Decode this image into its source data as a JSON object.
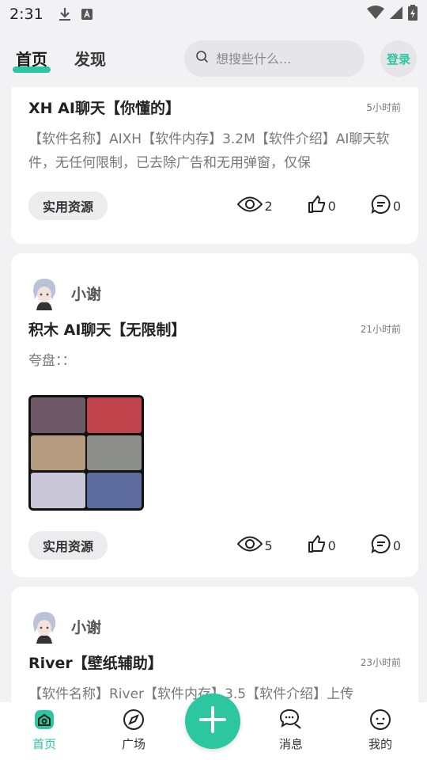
{
  "status_bar": {
    "time": "2:31"
  },
  "header": {
    "tabs": [
      {
        "label": "首页",
        "active": true
      },
      {
        "label": "发现",
        "active": false
      }
    ],
    "search": {
      "placeholder": "想搜些什么..."
    },
    "login_label": "登录"
  },
  "posts": [
    {
      "title": "XH AI聊天【你懂的】",
      "time": "5小时前",
      "excerpt": "【软件名称】AIXH【软件内存】3.2M【软件介绍】AI聊天软件，无任何限制，已去除广告和无用弹窗，仅保",
      "tag": "实用资源",
      "views": "2",
      "likes": "0",
      "comments": "0"
    },
    {
      "author": "小谢",
      "title": "积木 AI聊天【无限制】",
      "time": "21小时前",
      "excerpt": "夸盘：：",
      "tag": "实用资源",
      "views": "5",
      "likes": "0",
      "comments": "0"
    },
    {
      "author": "小谢",
      "title": "River【壁纸辅助】",
      "time": "23小时前",
      "excerpt": "【软件名称】River【软件内存】3.5【软件介绍】上传"
    }
  ],
  "bottom_nav": [
    {
      "label": "首页",
      "icon": "home-icon",
      "active": true
    },
    {
      "label": "广场",
      "icon": "compass-icon",
      "active": false
    },
    {
      "label": "消息",
      "icon": "chat-icon",
      "active": false
    },
    {
      "label": "我的",
      "icon": "profile-icon",
      "active": false
    }
  ],
  "colors": {
    "accent": "#2cc6a0",
    "background": "#f2f2f4"
  }
}
